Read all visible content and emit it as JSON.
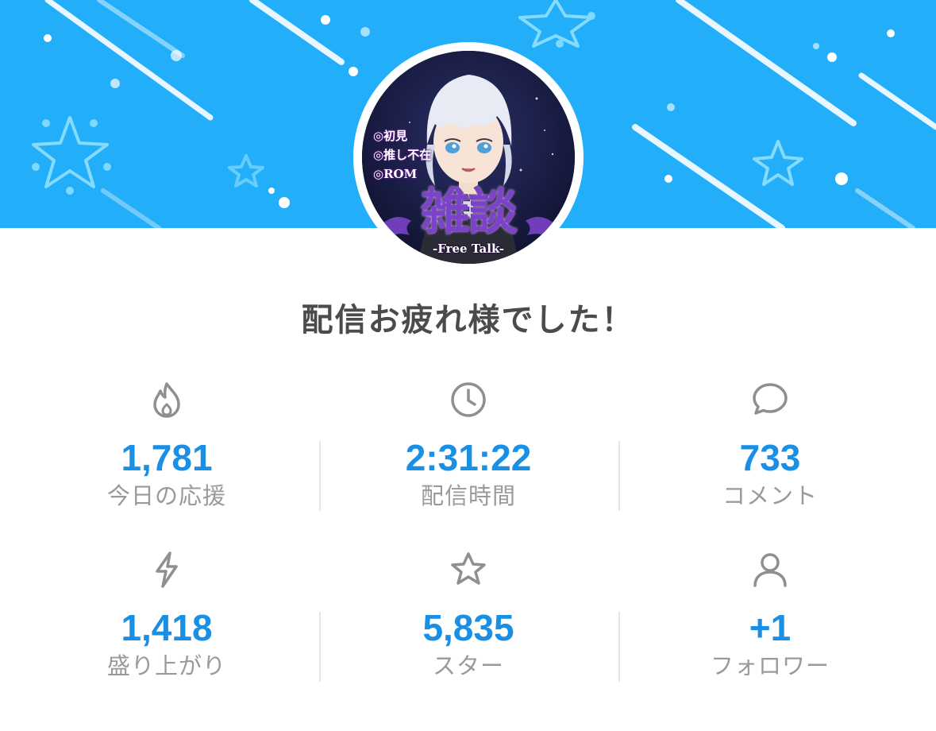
{
  "banner": {
    "background_color": "#22aef8",
    "decoration": "stars-and-streaks"
  },
  "thumbnail": {
    "lines": [
      "◎初見",
      "◎推し不在",
      "◎ROM"
    ],
    "title": "雑談",
    "subtitle": "-Free Talk-"
  },
  "headline": "配信お疲れ様でした！",
  "stats": [
    {
      "icon": "fire-icon",
      "value": "1,781",
      "label": "今日の応援"
    },
    {
      "icon": "clock-icon",
      "value": "2:31:22",
      "label": "配信時間"
    },
    {
      "icon": "comment-bubble-icon",
      "value": "733",
      "label": "コメント"
    },
    {
      "icon": "lightning-icon",
      "value": "1,418",
      "label": "盛り上がり"
    },
    {
      "icon": "star-icon",
      "value": "5,835",
      "label": "スター"
    },
    {
      "icon": "person-icon",
      "value": "+1",
      "label": "フォロワー"
    }
  ],
  "colors": {
    "accent_value": "#1a8fe6",
    "label_gray": "#9a9a9a",
    "headline": "#4b4b4b"
  }
}
